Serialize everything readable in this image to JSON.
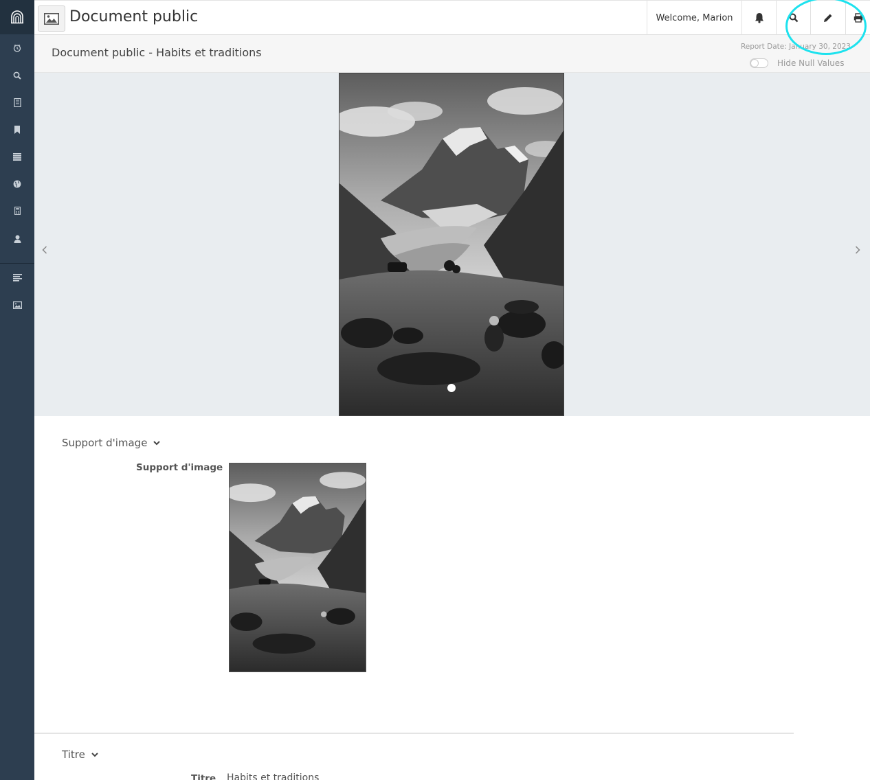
{
  "header": {
    "title": "Document public",
    "welcome": "Welcome, Marion"
  },
  "subheader": {
    "title": "Document public - Habits et traditions",
    "report_date": "Report Date: January 30, 2023",
    "hide_null_label": "Hide Null Values",
    "hide_null_enabled": false
  },
  "sidebar": {
    "items": [
      "clock-icon",
      "search-icon",
      "book-icon",
      "bookmark-icon",
      "list-icon",
      "globe-icon",
      "calculator-icon",
      "user-icon",
      "align-left-icon",
      "image-icon"
    ]
  },
  "sections": [
    {
      "header": "Support d'image",
      "label": "Support d'image"
    },
    {
      "header": "Titre",
      "label": "Titre",
      "value": "Habits et traditions"
    }
  ],
  "colors": {
    "sidebar": "#2d3e50",
    "sidebar_logo_bg": "#22313f",
    "highlight": "#1de2ee"
  }
}
